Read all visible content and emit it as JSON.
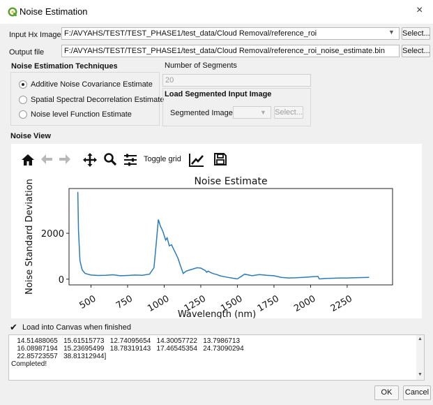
{
  "window": {
    "title": "Noise Estimation",
    "close_glyph": "×",
    "icon": "qgis-icon"
  },
  "inputs": {
    "input_label": "Input Hx Image",
    "input_value": "F:/AVYAHS/TEST/TEST_PHASE1/test_data/Cloud Removal/reference_roi",
    "input_select": "Select...",
    "output_label": "Output file",
    "output_value": "F:/AVYAHS/TEST/TEST_PHASE1/test_data/Cloud Removal/reference_roi_noise_estimate.bin",
    "output_select": "Select..."
  },
  "techniques": {
    "heading": "Noise Estimation Techniques",
    "options": [
      {
        "label": "Additive Noise Covariance Estimate",
        "checked": true
      },
      {
        "label": "Spatial Spectral Decorrelation Estimate",
        "checked": false
      },
      {
        "label": "Noise level Function Estimate",
        "checked": false
      }
    ]
  },
  "segments": {
    "label": "Number of Segments",
    "value": "20",
    "load_heading": "Load Segmented Input Image",
    "seg_label": "Segmented Image",
    "seg_select": "Select..."
  },
  "noise_view": {
    "heading": "Noise View",
    "toggle_grid": "Toggle grid",
    "toolbar_icons": [
      "home-icon",
      "back-arrow-icon",
      "forward-arrow-icon",
      "pan-icon",
      "zoom-icon",
      "configure-subplots-icon",
      "edit-axis-icon",
      "save-icon"
    ]
  },
  "chart_data": {
    "type": "line",
    "title": "Noise Estimate",
    "ylabel": "Noise Standard Deviation",
    "xlabel": "Wavelength (nm)",
    "xlim": [
      350,
      2560
    ],
    "ylim": [
      -250,
      3950
    ],
    "xticks": [
      500,
      750,
      1000,
      1250,
      1500,
      1750,
      2000,
      2250
    ],
    "yticks": [
      0,
      2000
    ],
    "color": "#2b7bb9",
    "x": [
      410,
      415,
      425,
      440,
      460,
      500,
      550,
      600,
      650,
      700,
      750,
      800,
      850,
      900,
      930,
      945,
      960,
      975,
      990,
      1000,
      1010,
      1020,
      1035,
      1050,
      1065,
      1080,
      1095,
      1110,
      1130,
      1150,
      1175,
      1200,
      1225,
      1250,
      1265,
      1280,
      1290,
      1300,
      1320,
      1340,
      1360,
      1380,
      1400,
      1450,
      1500,
      1550,
      1600,
      1650,
      1700,
      1750,
      1800,
      1850,
      1900,
      1950,
      2000,
      2050,
      2060,
      2100,
      2150,
      2200,
      2250,
      2300,
      2350,
      2400
    ],
    "y": [
      3800,
      2100,
      800,
      400,
      250,
      180,
      160,
      170,
      190,
      150,
      160,
      180,
      170,
      220,
      500,
      1500,
      2600,
      2300,
      2100,
      1900,
      1700,
      1800,
      1450,
      1500,
      1300,
      1100,
      900,
      600,
      250,
      350,
      400,
      450,
      500,
      480,
      430,
      380,
      300,
      350,
      280,
      230,
      200,
      150,
      120,
      60,
      10,
      220,
      150,
      200,
      170,
      150,
      80,
      50,
      60,
      80,
      100,
      120,
      10,
      30,
      40,
      50,
      50,
      60,
      70,
      80
    ]
  },
  "canvas_option": {
    "checked": true,
    "label": "Load into Canvas when finished"
  },
  "log": {
    "lines": [
      "   14.51488065   15.61515773   12.74095654   14.30057722   13.7986713",
      "   16.08987194   15.23695499   18.78319143   17.46545354   24.73090294",
      "   22.85723557   38.81312944]",
      "Completed!"
    ]
  },
  "buttons": {
    "ok": "OK",
    "cancel": "Cancel"
  }
}
